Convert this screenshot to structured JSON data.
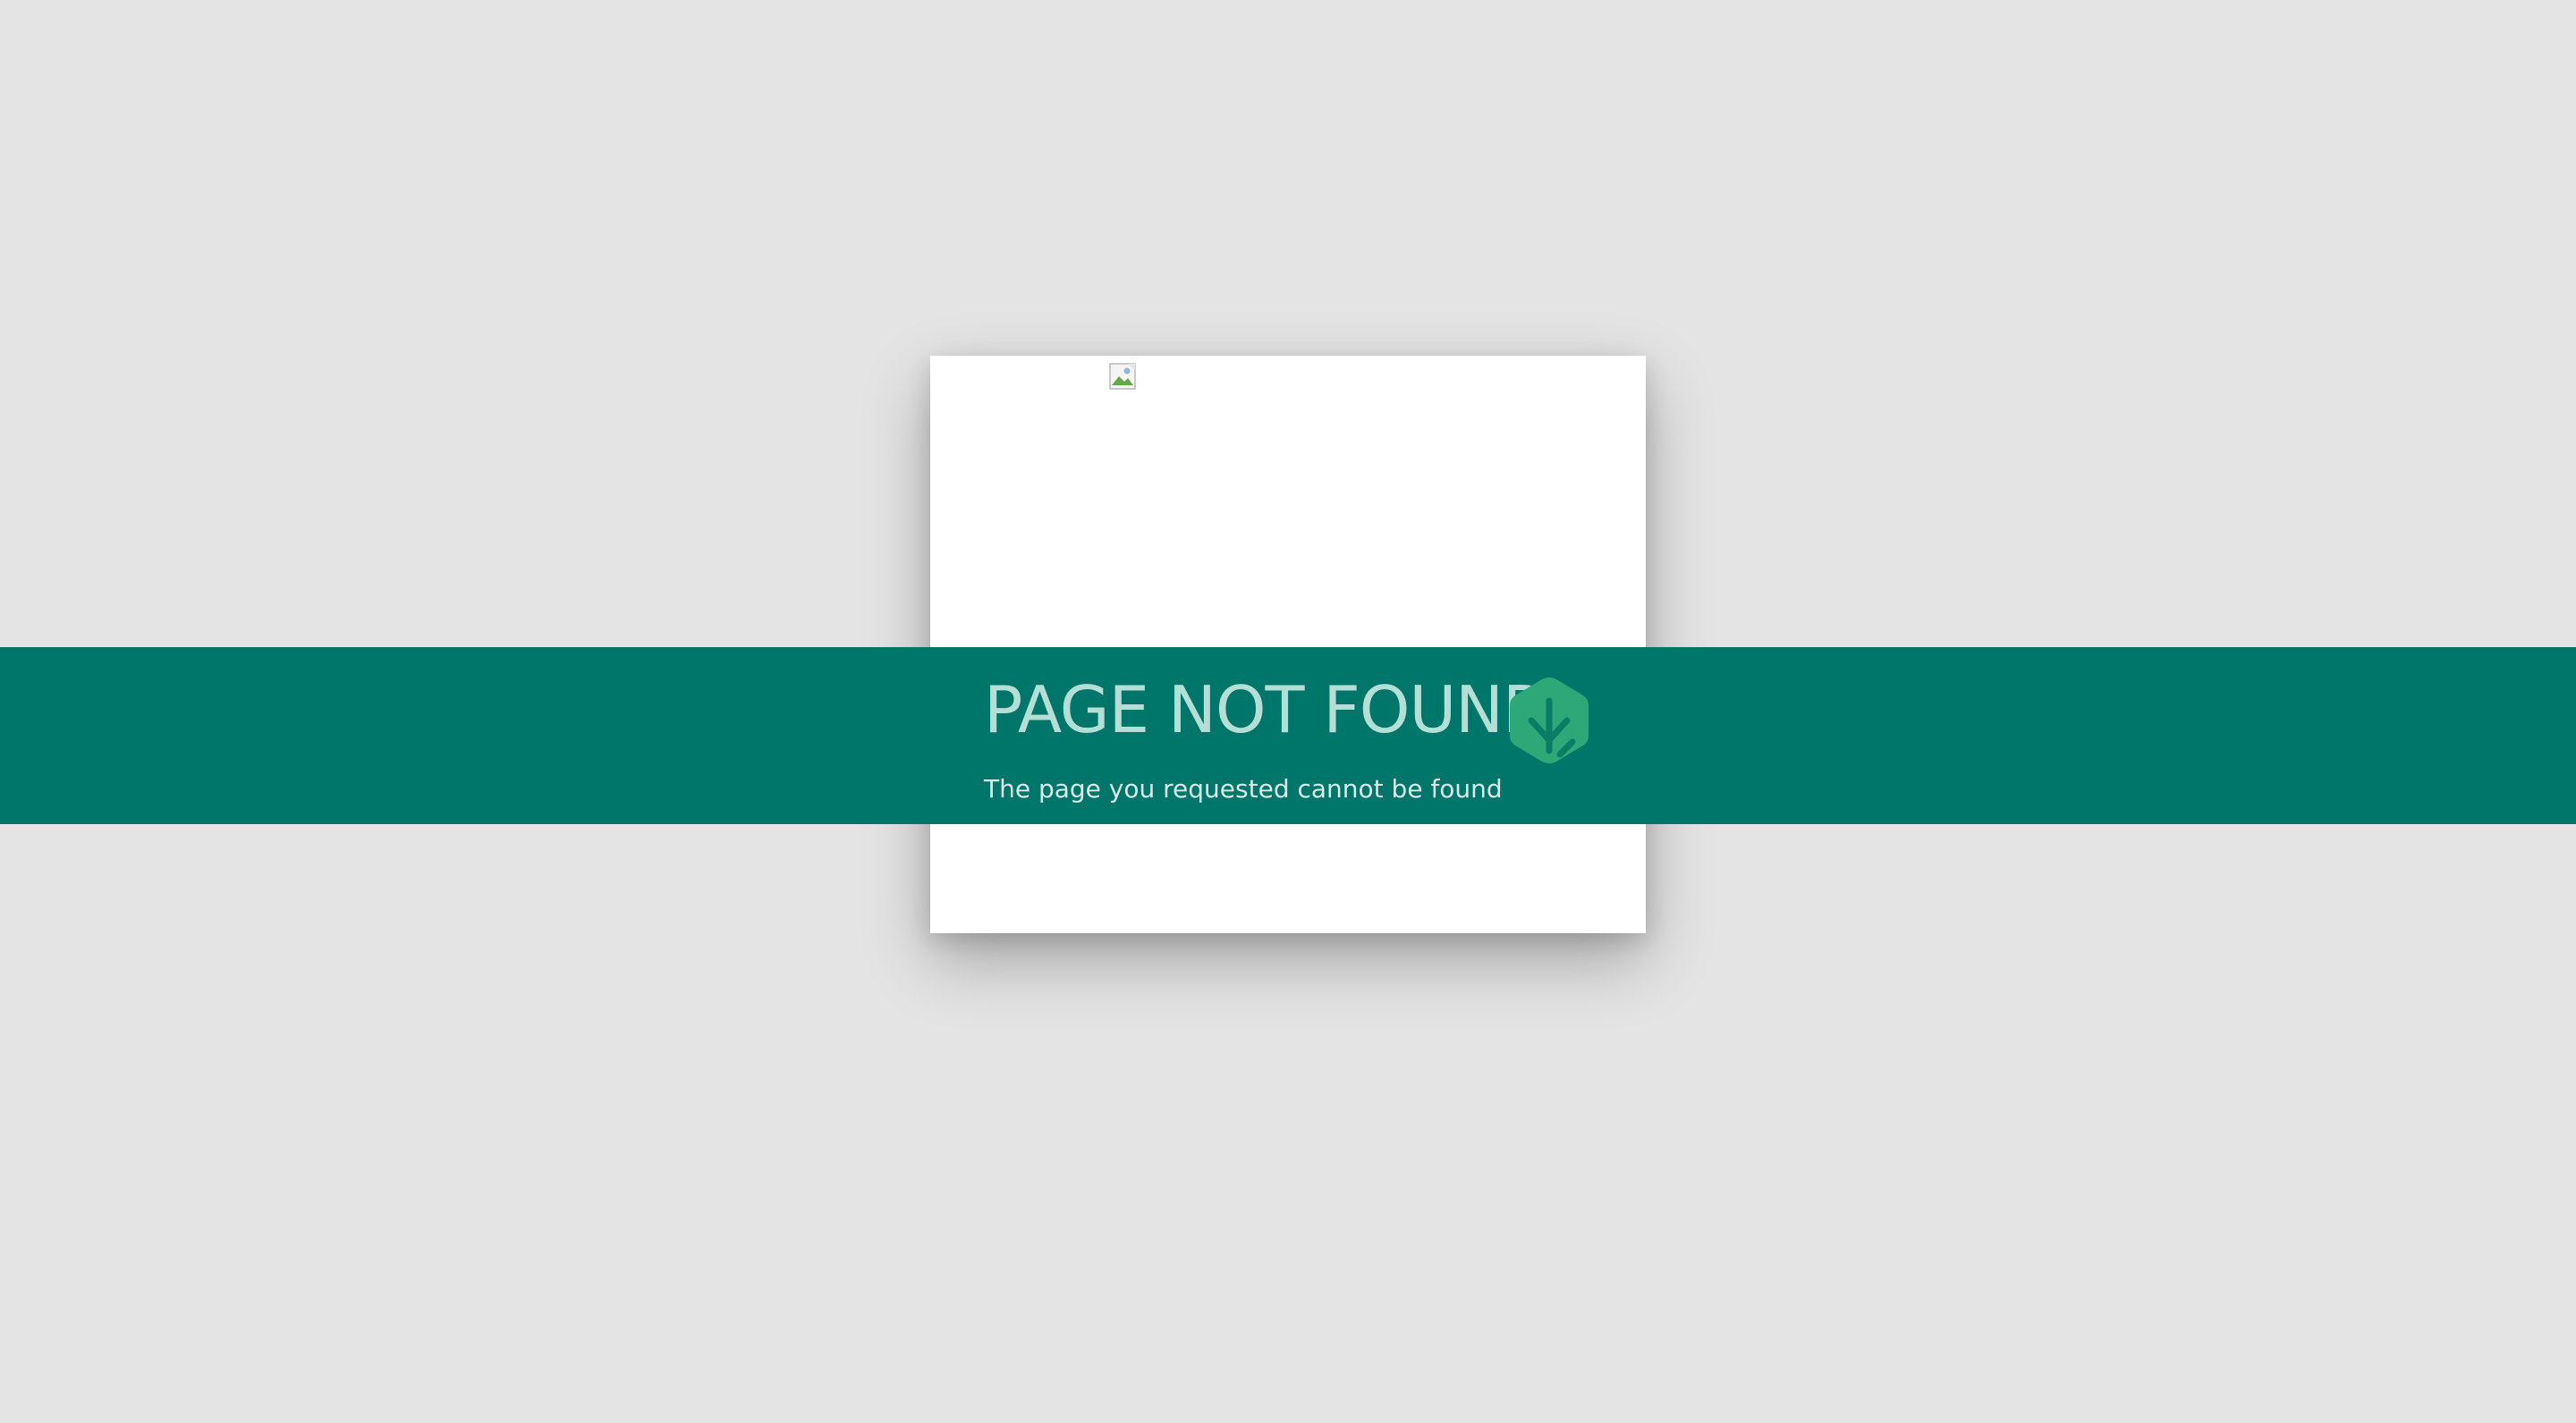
{
  "error": {
    "title": "PAGE NOT FOUND",
    "message": "The page you requested cannot be found"
  },
  "icons": {
    "broken_image": "broken-image-icon",
    "logo": "leaf-hexagon-icon"
  },
  "colors": {
    "background": "#e4e4e4",
    "band": "#00766b",
    "title_text": "#b3dfd6",
    "logo_fill": "#2fa879"
  }
}
